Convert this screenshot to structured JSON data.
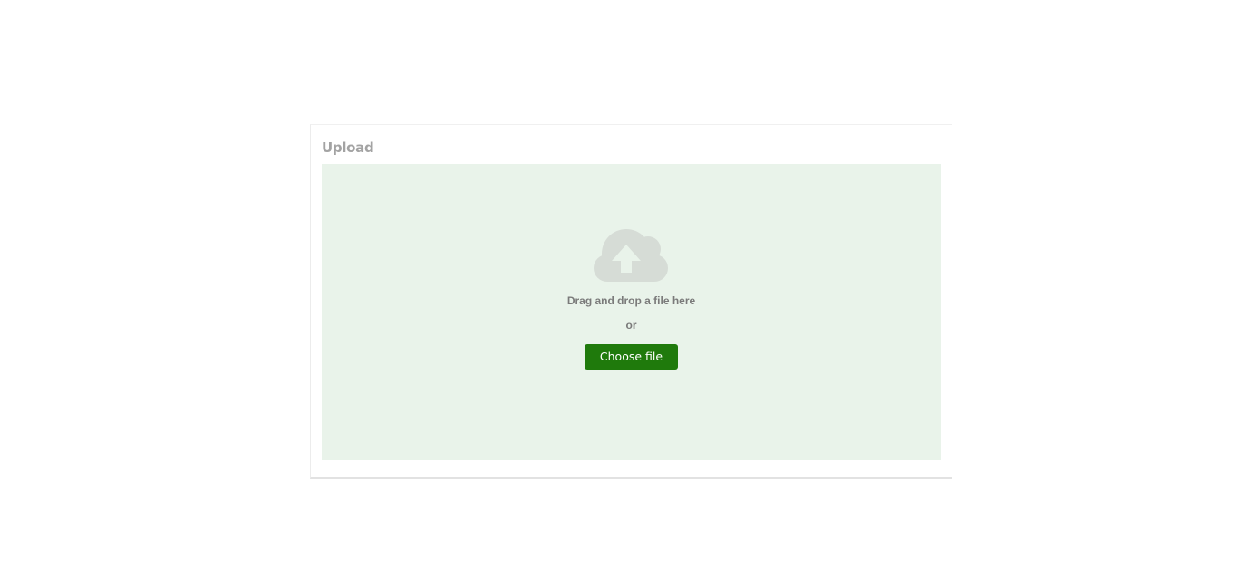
{
  "upload": {
    "title": "Upload",
    "dropzone": {
      "icon": "cloud-upload-icon",
      "instruction": "Drag and drop a file here",
      "separator": "or",
      "button_label": "Choose file"
    }
  },
  "colors": {
    "dropzone_bg": "#e9f3ea",
    "button_bg": "#1f7a0c",
    "icon": "#d6dcd6",
    "title": "#a3a3a3"
  }
}
